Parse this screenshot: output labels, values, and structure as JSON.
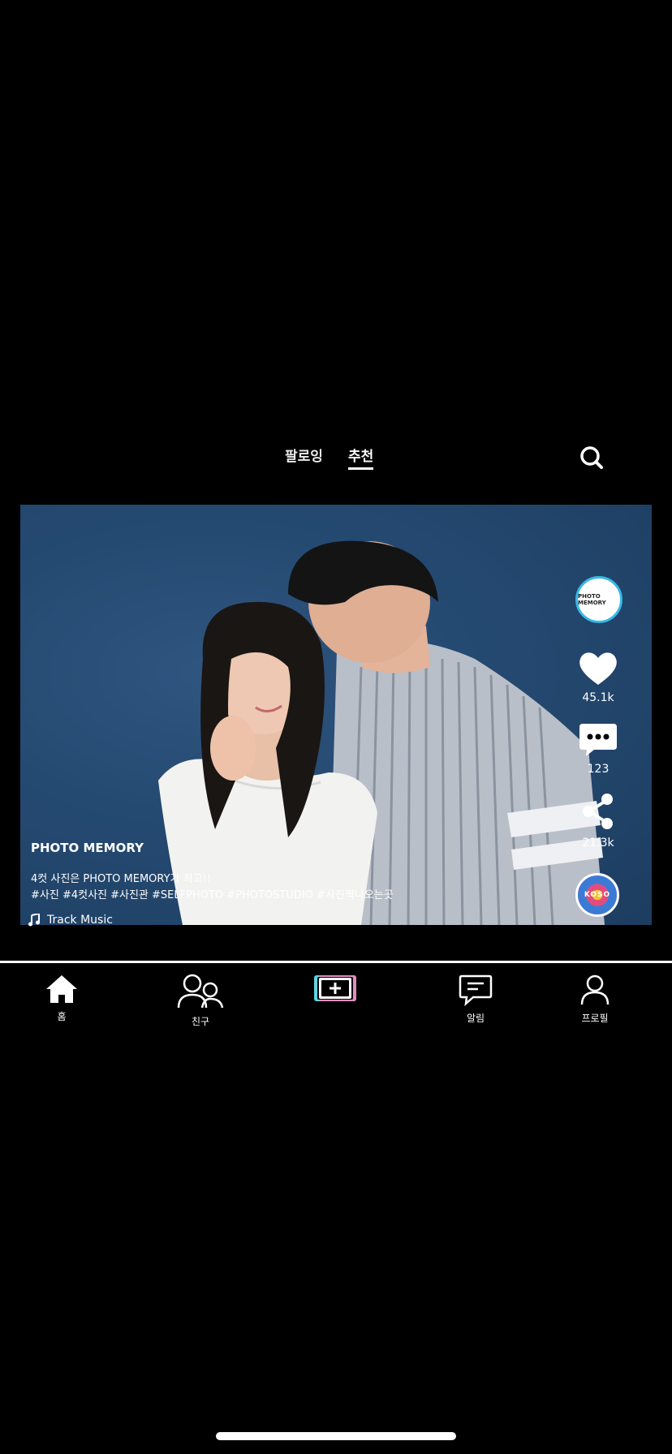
{
  "feed_tabs": {
    "following": "팔로잉",
    "recommended": "추천",
    "active": "recommended"
  },
  "search": {
    "icon": "search-icon"
  },
  "video": {
    "author": "PHOTO MEMORY",
    "caption_line1": "4컷 사진은 PHOTO MEMORY가 최고!!",
    "caption_line2": "#사진 #4컷사진 #사진관 #SELFPHOTO #PHOTOSTUDIO #사진찍나오는곳",
    "music": "Track Music",
    "avatar_logo": "PHOTO MEMORY",
    "disc_logo": "KOSO"
  },
  "actions": {
    "likes": "45.1k",
    "comments": "123",
    "shares": "21.3k"
  },
  "bottom_nav": {
    "home": "홈",
    "friends": "친구",
    "create": "",
    "notifications": "알림",
    "profile": "프로필"
  },
  "colors": {
    "background": "#000000",
    "avatar_ring": "#38b8e6",
    "create_left": "#5fd3e0",
    "create_right": "#e58bc2"
  }
}
